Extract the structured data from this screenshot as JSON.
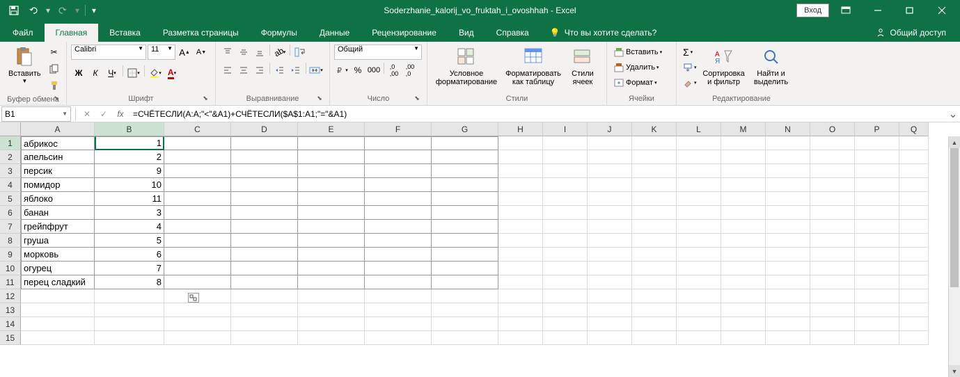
{
  "title": "Soderzhanie_kalorij_vo_fruktah_i_ovoshhah - Excel",
  "login_label": "Вход",
  "tabs": {
    "file": "Файл",
    "home": "Главная",
    "insert": "Вставка",
    "layout": "Разметка страницы",
    "formulas": "Формулы",
    "data": "Данные",
    "review": "Рецензирование",
    "view": "Вид",
    "help": "Справка",
    "tell_me": "Что вы хотите сделать?",
    "share": "Общий доступ"
  },
  "ribbon": {
    "clipboard": {
      "paste": "Вставить",
      "label": "Буфер обмена"
    },
    "font": {
      "name": "Calibri",
      "size": "11",
      "label": "Шрифт"
    },
    "alignment": {
      "label": "Выравнивание"
    },
    "number": {
      "format": "Общий",
      "label": "Число"
    },
    "styles": {
      "cond": "Условное форматирование",
      "table": "Форматировать как таблицу",
      "cell": "Стили ячеек",
      "label": "Стили"
    },
    "cells": {
      "insert": "Вставить",
      "delete": "Удалить",
      "format": "Формат",
      "label": "Ячейки"
    },
    "editing": {
      "sort": "Сортировка и фильтр",
      "find": "Найти и выделить",
      "label": "Редактирование"
    }
  },
  "name_box": "B1",
  "formula": "=СЧЁТЕСЛИ(A:A;\"<\"&A1)+СЧЁТЕСЛИ($A$1:A1;\"=\"&A1)",
  "columns": [
    "A",
    "B",
    "C",
    "D",
    "E",
    "F",
    "G",
    "H",
    "I",
    "J",
    "K",
    "L",
    "M",
    "N",
    "O",
    "P",
    "Q"
  ],
  "row_count": 15,
  "chart_data": {
    "type": "table",
    "columns": [
      "A",
      "B"
    ],
    "rows": [
      {
        "A": "абрикос",
        "B": 1
      },
      {
        "A": "апельсин",
        "B": 2
      },
      {
        "A": "персик",
        "B": 9
      },
      {
        "A": "помидор",
        "B": 10
      },
      {
        "A": "яблоко",
        "B": 11
      },
      {
        "A": "банан",
        "B": 3
      },
      {
        "A": "грейпфрут",
        "B": 4
      },
      {
        "A": "груша",
        "B": 5
      },
      {
        "A": "морковь",
        "B": 6
      },
      {
        "A": "огурец",
        "B": 7
      },
      {
        "A": "перец сладкий",
        "B": 8
      }
    ]
  },
  "active_cell": {
    "row": 1,
    "col": "B"
  },
  "col_widths": {
    "A": 106,
    "B": 100,
    "C": 96,
    "D": 96,
    "E": 96,
    "F": 96,
    "G": 96,
    "H": 64,
    "I": 64,
    "J": 64,
    "K": 64,
    "L": 64,
    "M": 64,
    "N": 64,
    "O": 64,
    "P": 64,
    "Q": 42
  }
}
